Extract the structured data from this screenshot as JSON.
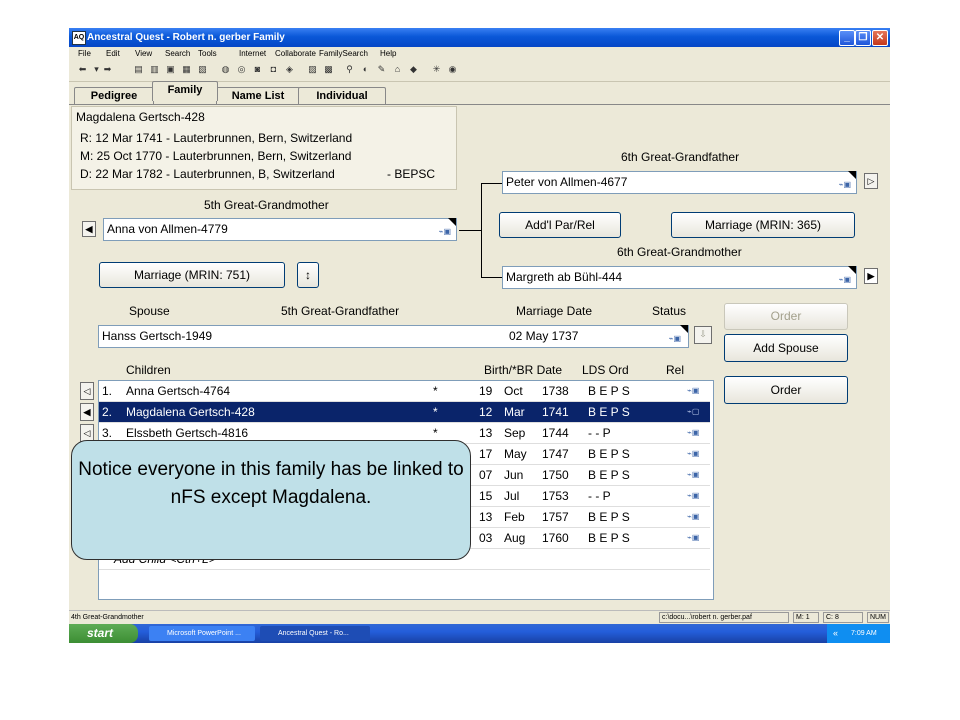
{
  "window": {
    "title": "Ancestral Quest - Robert n. gerber Family",
    "app_icon": "AQ"
  },
  "menu": [
    "File",
    "Edit",
    "View",
    "Search",
    "Tools",
    "Internet",
    "Collaborate",
    "FamilySearch",
    "Help"
  ],
  "tabs": [
    {
      "label": "Pedigree"
    },
    {
      "label": "Family",
      "active": true
    },
    {
      "label": "Name List"
    },
    {
      "label": "Individual"
    }
  ],
  "person_info": {
    "name": "Magdalena Gertsch-428",
    "r": "R: 12 Mar 1741 - Lauterbrunnen, Bern, Switzerland",
    "m": "M: 25 Oct 1770 - Lauterbrunnen, Bern, Switzerland",
    "d": "D: 22 Mar 1782 - Lauterbrunnen, B, Switzerland",
    "d_code": "- BEPSC"
  },
  "parents": {
    "father_rel": "6th Great-Grandfather",
    "father": "Peter von Allmen-4677",
    "mother_rel": "6th Great-Grandmother",
    "mother": "Margreth ab Bühl-444",
    "addl_button": "Add'l Par/Rel",
    "marriage_button": "Marriage (MRIN: 365)"
  },
  "wife": {
    "rel": "5th Great-Grandmother",
    "name": "Anna von Allmen-4779",
    "marriage_button": "Marriage (MRIN: 751)"
  },
  "spouse": {
    "header_spouse": "Spouse",
    "header_rel": "5th Great-Grandfather",
    "header_date": "Marriage Date",
    "header_status": "Status",
    "name": "Hanss Gertsch-1949",
    "date": "02  May  1737"
  },
  "buttons": {
    "order_disabled": "Order",
    "add_spouse": "Add Spouse",
    "order": "Order"
  },
  "children_headers": {
    "children": "Children",
    "birth": "Birth/*BR Date",
    "lds": "LDS Ord",
    "rel": "Rel"
  },
  "children": [
    {
      "num": "1.",
      "name": "Anna Gertsch-4764",
      "star": "*",
      "day": "19",
      "mon": "Oct",
      "year": "1738",
      "lds": "B E P S"
    },
    {
      "num": "2.",
      "name": "Magdalena Gertsch-428",
      "star": "*",
      "day": "12",
      "mon": "Mar",
      "year": "1741",
      "lds": "B E P S",
      "selected": true
    },
    {
      "num": "3.",
      "name": "Elssbeth Gertsch-4816",
      "star": "*",
      "day": "13",
      "mon": "Sep",
      "year": "1744",
      "lds": "-  -  P"
    },
    {
      "num": "4.",
      "name": "",
      "star": "",
      "day": "17",
      "mon": "May",
      "year": "1747",
      "lds": "B E P S"
    },
    {
      "num": "5.",
      "name": "",
      "star": "",
      "day": "07",
      "mon": "Jun",
      "year": "1750",
      "lds": "B E P S"
    },
    {
      "num": "6.",
      "name": "",
      "star": "",
      "day": "15",
      "mon": "Jul",
      "year": "1753",
      "lds": "-  -  P"
    },
    {
      "num": "7.",
      "name": "",
      "star": "",
      "day": "13",
      "mon": "Feb",
      "year": "1757",
      "lds": "B E P S"
    },
    {
      "num": "8.",
      "name": "",
      "star": "",
      "day": "03",
      "mon": "Aug",
      "year": "1760",
      "lds": "B E P S"
    }
  ],
  "add_child": "Add Child <Ctrl+L>",
  "status_bar": {
    "left": "4th Great-Grandmother",
    "path": "c:\\docu...\\robert n. gerber.paf",
    "m": "M: 1",
    "c": "C: 8",
    "num": "NUM"
  },
  "taskbar": {
    "start": "start",
    "items": [
      "Microsoft PowerPoint ...",
      "Ancestral Quest - Ro..."
    ],
    "time": "7:09 AM"
  },
  "callout": "Notice everyone in this family has be linked to nFS except Magdalena."
}
